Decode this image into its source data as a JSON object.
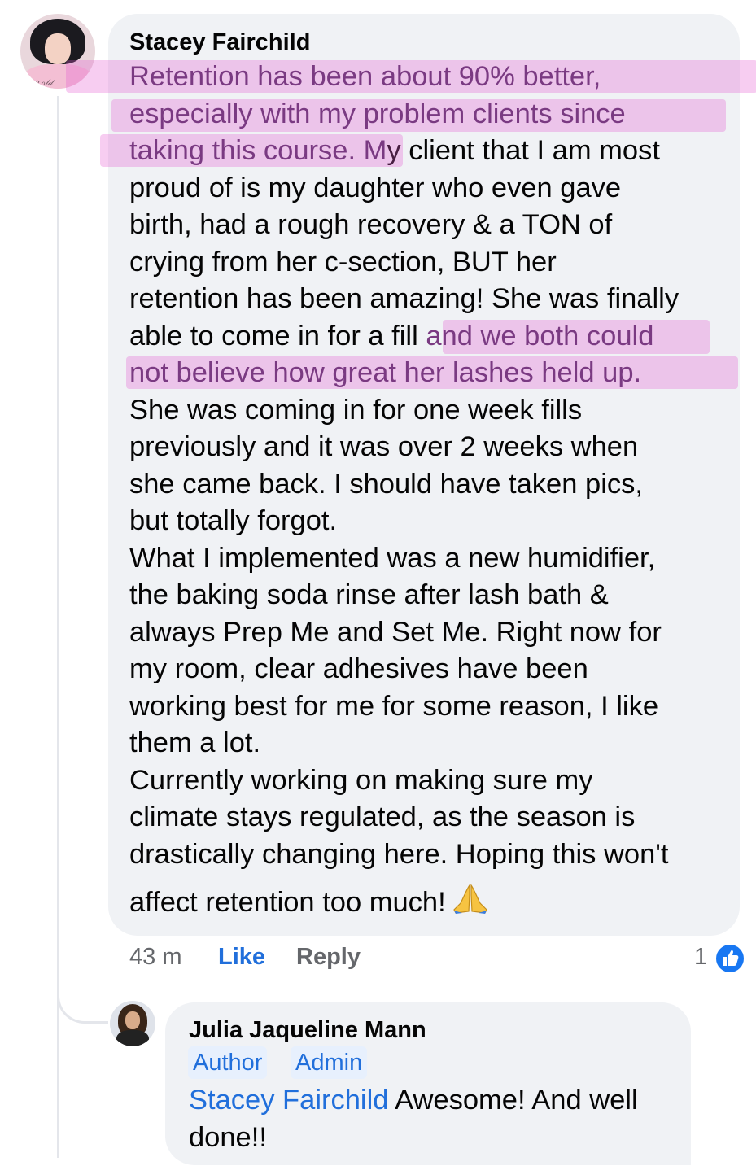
{
  "comment": {
    "author": "Stacey Fairchild",
    "lines": [
      "Retention has been about 90% better,",
      "especially with my problem clients since",
      "taking this course. My client that I am most",
      "proud of is my daughter who even gave",
      "birth, had a rough recovery & a TON of",
      "crying from her c-section, BUT her",
      "retention has been amazing! She was finally",
      "able to come in for a fill and we both could",
      "not believe how great her lashes held up.",
      "She was coming in for one week fills",
      "previously and it was over 2 weeks when",
      "she came back. I should have taken pics,",
      "but totally forgot.",
      "What I implemented was a new humidifier,",
      "the baking soda rinse after lash bath &",
      "always Prep Me and Set Me. Right now for",
      "my room, clear adhesives have been",
      "working best for me for some reason, I like",
      "them a lot.",
      "Currently working on making sure my",
      "climate stays regulated, as the season is",
      "drastically changing here. Hoping this won't",
      "affect retention too much!"
    ],
    "seg_course": "taking this course. M",
    "seg_course_rest": "y client that I am most",
    "seg_fill": "able to come in for a fill ",
    "seg_fill_hl": "and we both could",
    "time": "43 m",
    "like_label": "Like",
    "reply_label": "Reply",
    "reaction_count": "1",
    "emoji_icon": "folded-hands-emoji"
  },
  "reply": {
    "author": "Julia Jaqueline Mann",
    "badges": [
      "Author",
      "Admin"
    ],
    "mention": "Stacey Fairchild",
    "text_line1": " Awesome! And well",
    "text_line2": "done!!"
  },
  "colors": {
    "accent": "#216fdb",
    "highlight": "#e65ad2",
    "bubble": "#f0f2f5",
    "meta": "#65676b"
  }
}
